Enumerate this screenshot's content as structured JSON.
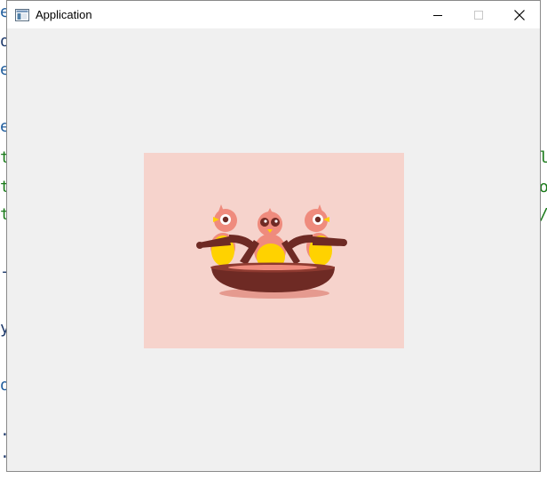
{
  "window": {
    "title": "Application",
    "icons": {
      "app": "application-window-icon",
      "minimize": "minimize-icon",
      "maximize": "maximize-icon",
      "close": "close-icon"
    }
  },
  "background_editor": {
    "left_glyphs": [
      "e",
      "o",
      "e",
      "e",
      "t",
      "t",
      "t",
      "-",
      "y",
      "o",
      ".",
      "."
    ],
    "right_glyphs": [
      "l",
      "o",
      "/"
    ]
  },
  "illustration": {
    "subject": "three-baby-birds-in-nest",
    "colors": {
      "background": "#f6d3cc",
      "bird_body": "#ef8b7d",
      "bird_belly": "#ffd200",
      "wing": "#6e2a24",
      "nest": "#6e2a24",
      "nest_rim": "#8e3a30",
      "shadow": "#e59a8f"
    }
  }
}
